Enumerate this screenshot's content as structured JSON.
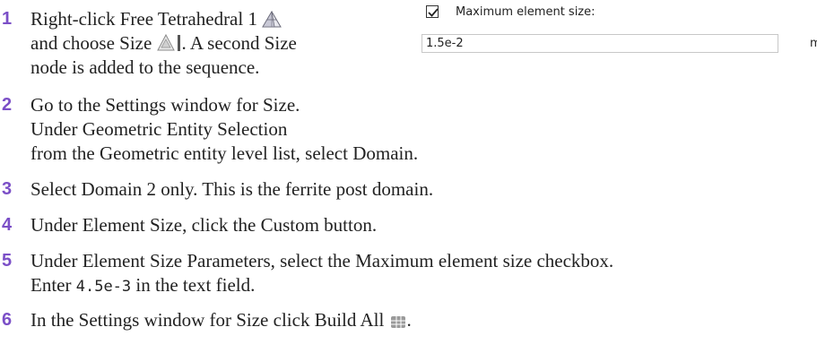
{
  "steps": [
    {
      "num": "1",
      "lines": [
        {
          "before": "Right-click Free Tetrahedral 1",
          "icon": "tetrahedral-icon",
          "after": ""
        },
        {
          "before": "and choose Size",
          "icon": "size-icon",
          "after": ". A second Size"
        },
        {
          "text": "node is added to the sequence."
        }
      ]
    },
    {
      "num": "2",
      "lines": [
        {
          "text": "Go to the Settings window for Size."
        },
        {
          "text": "Under Geometric Entity Selection"
        },
        {
          "text": "from the Geometric entity level list, select Domain."
        }
      ]
    },
    {
      "num": "3",
      "lines": [
        {
          "text": "Select Domain 2 only. This is the ferrite post domain."
        }
      ]
    },
    {
      "num": "4",
      "lines": [
        {
          "text": "Under Element Size, click the Custom button."
        }
      ]
    },
    {
      "num": "5",
      "lines": [
        {
          "text": "Under Element Size Parameters, select the Maximum element size checkbox."
        },
        {
          "before": "Enter ",
          "code": "4.5e-3",
          "after": " in the text field."
        }
      ]
    },
    {
      "num": "6",
      "lines": [
        {
          "before": "In the Settings window for Size click Build All",
          "icon": "build-all-icon",
          "after": "."
        }
      ]
    }
  ],
  "ui_panel": {
    "checkbox_label": "Maximum element size:",
    "checkbox_checked": true,
    "field_value": "1.5e-2",
    "unit": "m"
  },
  "colors": {
    "step_number": "#7b4fc7",
    "text": "#222222"
  }
}
